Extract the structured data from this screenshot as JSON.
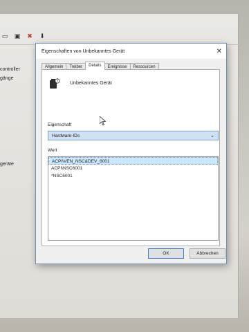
{
  "background": {
    "toolbar_icons": [
      "maximize-icon",
      "monitor-icon",
      "close-red-icon",
      "download-icon"
    ],
    "labels": [
      "controller",
      "gänge",
      "geräte"
    ]
  },
  "dialog": {
    "title": "Eigenschaften von Unbekanntes Gerät",
    "close_glyph": "✕",
    "tabs": [
      "Allgemein",
      "Treiber",
      "Details",
      "Ereignisse",
      "Ressourcen"
    ],
    "active_tab": "Details",
    "device_name": "Unbekanntes Gerät",
    "property_label": "Eigenschaft",
    "property_value": "Hardware-IDs",
    "value_label": "Wert",
    "values": [
      "ACPI\\VEN_NSC&DEV_6001",
      "ACPI\\NSC6001",
      "*NSC6001"
    ],
    "selected_value_index": 0,
    "ok_label": "OK",
    "cancel_label": "Abbrechen"
  },
  "colors": {
    "accent": "#3b7bd6",
    "selection": "#cce8ff",
    "dropdown_bg": "#cfe1f3"
  }
}
